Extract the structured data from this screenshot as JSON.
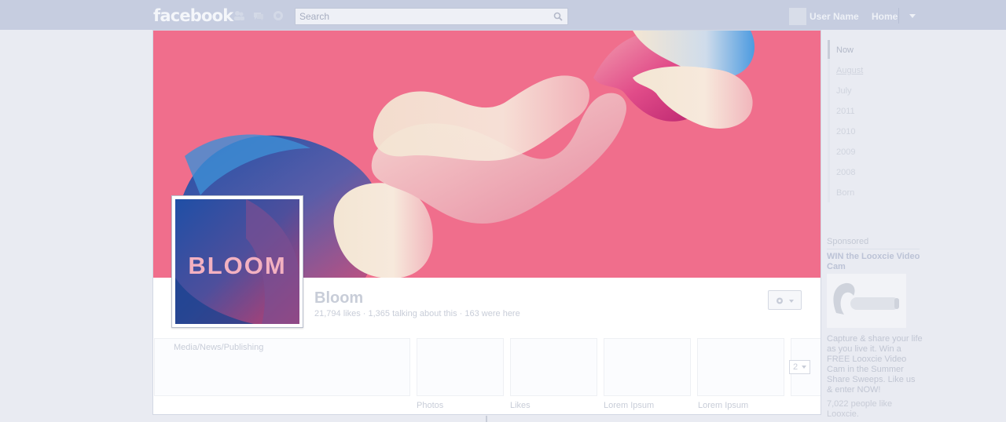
{
  "topbar": {
    "logo": "facebook",
    "search_placeholder": "Search",
    "user_name": "User Name",
    "home": "Home"
  },
  "page": {
    "cover_logo_text": "BLOOM",
    "name": "Bloom",
    "stats": "21,794 likes · 1,365 talking about this · 163 were here",
    "category": "Media/News/Publishing"
  },
  "apps": {
    "items": [
      {
        "label": "Photos"
      },
      {
        "label": "Likes"
      },
      {
        "label": "Lorem Ipsum"
      },
      {
        "label": "Lorem Ipsum"
      }
    ],
    "more_count": "2"
  },
  "timeline_scrubber": {
    "items": [
      "Now",
      "August",
      "July",
      "2011",
      "2010",
      "2009",
      "2008",
      "Born"
    ]
  },
  "sponsored": {
    "heading": "Sponsored",
    "ad_title": "WIN the Looxcie Video Cam",
    "ad_body": "Capture & share your life as you live it. Win a FREE Looxcie Video Cam in the Summer Share Sweeps. Like us & enter NOW!",
    "ad_likes": "7,022 people like Looxcie."
  },
  "colors": {
    "topbar": "#c6cde0",
    "cover_pink": "#f06e8c",
    "text_muted": "#c8cdd8"
  }
}
